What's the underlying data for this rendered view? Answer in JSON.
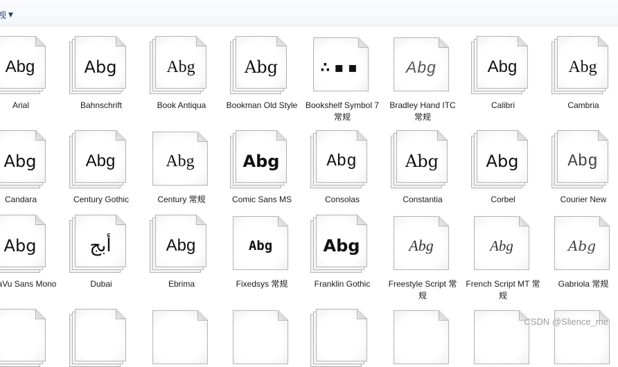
{
  "toolbar": {
    "view_label": "视",
    "dropdown_icon": "caret-down-icon"
  },
  "fonts": [
    {
      "label": "Arial",
      "sample": "Abg"
    },
    {
      "label": "Bahnschrift",
      "sample": "Abg"
    },
    {
      "label": "Book Antiqua",
      "sample": "Abg"
    },
    {
      "label": "Bookman Old Style",
      "sample": "Abg"
    },
    {
      "label": "Bookshelf Symbol 7 常规",
      "sample": "∴▪▪"
    },
    {
      "label": "Bradley Hand ITC 常规",
      "sample": "Abg"
    },
    {
      "label": "Calibri",
      "sample": "Abg"
    },
    {
      "label": "Cambria",
      "sample": "Abg"
    },
    {
      "label": "Candara",
      "sample": "Abg"
    },
    {
      "label": "Century Gothic",
      "sample": "Abg"
    },
    {
      "label": "Century 常规",
      "sample": "Abg"
    },
    {
      "label": "Comic Sans MS",
      "sample": "Abg"
    },
    {
      "label": "Consolas",
      "sample": "Abg"
    },
    {
      "label": "Constantia",
      "sample": "Abg"
    },
    {
      "label": "Corbel",
      "sample": "Abg"
    },
    {
      "label": "Courier New",
      "sample": "Abg"
    },
    {
      "label": "DejaVu Sans Mono",
      "sample": "Abg"
    },
    {
      "label": "Dubai",
      "sample": "أبج"
    },
    {
      "label": "Ebrima",
      "sample": "Abg"
    },
    {
      "label": "Fixedsys 常规",
      "sample": "Abg"
    },
    {
      "label": "Franklin Gothic",
      "sample": "Abg"
    },
    {
      "label": "Freestyle Script 常规",
      "sample": "Abg"
    },
    {
      "label": "French Script MT 常规",
      "sample": "Abg"
    },
    {
      "label": "Gabriola 常规",
      "sample": "Abg"
    }
  ],
  "watermark": "CSDN @Slience_me"
}
